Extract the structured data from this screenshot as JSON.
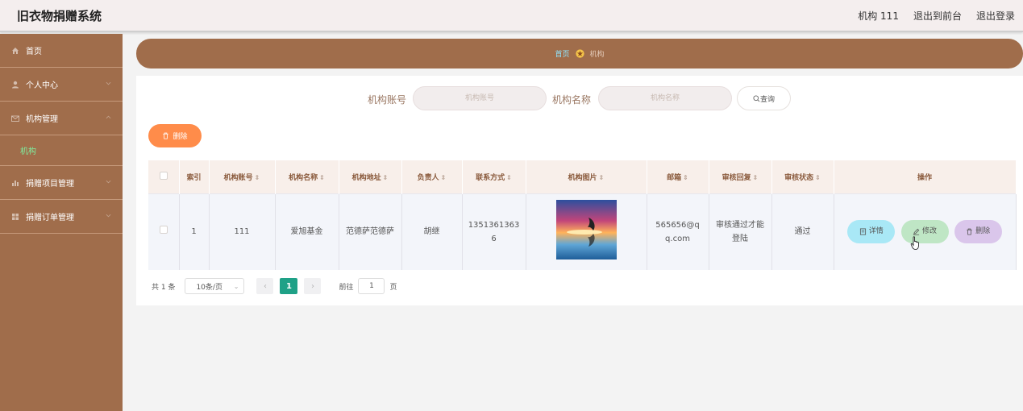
{
  "header": {
    "title": "旧衣物捐赠系统",
    "user_label": "机构 111",
    "frontend_link": "退出到前台",
    "logout_link": "退出登录"
  },
  "sidebar": {
    "items": [
      {
        "label": "首页",
        "icon": "home-icon"
      },
      {
        "label": "个人中心",
        "icon": "user-icon"
      },
      {
        "label": "机构管理",
        "icon": "mail-icon"
      },
      {
        "label": "机构",
        "icon": ""
      },
      {
        "label": "捐赠项目管理",
        "icon": "chart-icon"
      },
      {
        "label": "捐赠订单管理",
        "icon": "grid-icon"
      }
    ]
  },
  "breadcrumb": {
    "home": "首页",
    "current": "机构"
  },
  "search": {
    "account_label": "机构账号",
    "account_placeholder": "机构账号",
    "name_label": "机构名称",
    "name_placeholder": "机构名称",
    "query_button": "查询"
  },
  "toolbar": {
    "delete_label": "删除"
  },
  "table": {
    "headers": [
      "索引",
      "机构账号",
      "机构名称",
      "机构地址",
      "负责人",
      "联系方式",
      "机构图片",
      "邮箱",
      "审核回复",
      "审核状态",
      "操作"
    ],
    "rows": [
      {
        "index": "1",
        "account": "111",
        "name": "爱旭基金",
        "address": "范德萨范德萨",
        "manager": "胡继",
        "phone": "13513613636",
        "email": "565656@qq.com",
        "reply": "审核通过才能登陆",
        "status": "通过"
      }
    ],
    "actions": {
      "detail": "详情",
      "edit": "修改",
      "delete": "删除"
    }
  },
  "pagination": {
    "total": "共 1 条",
    "page_size": "10条/页",
    "current_page": "1",
    "goto_label": "前往",
    "goto_value": "1",
    "page_suffix": "页"
  },
  "colors": {
    "sidebar": "#a06d4b",
    "accent_orange": "#ff8c4a",
    "page_active": "#1fa187"
  }
}
